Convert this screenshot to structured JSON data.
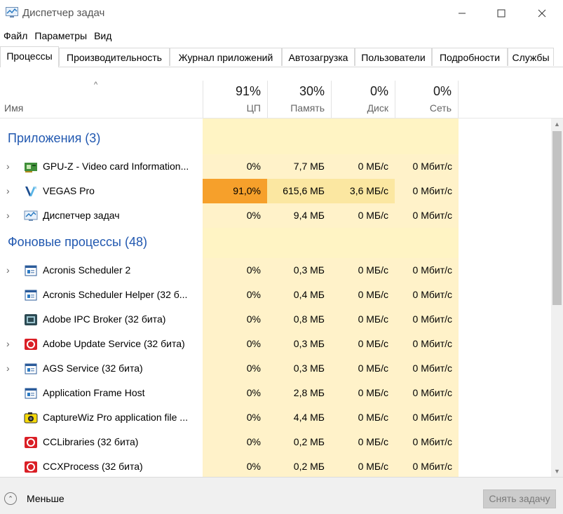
{
  "window": {
    "title": "Диспетчер задач",
    "minimize_glyph": "—",
    "maximize_glyph": "☐",
    "close_glyph": "✕"
  },
  "menu": [
    "Файл",
    "Параметры",
    "Вид"
  ],
  "tabs": [
    {
      "label": "Процессы",
      "active": true
    },
    {
      "label": "Производительность"
    },
    {
      "label": "Журнал приложений"
    },
    {
      "label": "Автозагрузка"
    },
    {
      "label": "Пользователи"
    },
    {
      "label": "Подробности"
    },
    {
      "label": "Службы"
    }
  ],
  "columns": {
    "name": "Имя",
    "sort_arrow": "^",
    "cpu": {
      "percent": "91%",
      "label": "ЦП"
    },
    "memory": {
      "percent": "30%",
      "label": "Память"
    },
    "disk": {
      "percent": "0%",
      "label": "Диск"
    },
    "network": {
      "percent": "0%",
      "label": "Сеть"
    }
  },
  "groups": [
    {
      "title": "Приложения (3)",
      "processes": [
        {
          "name": "GPU-Z - Video card Information...",
          "icon": "gpu-card-icon",
          "expandable": true,
          "cpu": "0%",
          "memory": "7,7 МБ",
          "disk": "0 МБ/с",
          "network": "0 Мбит/с",
          "level": 0
        },
        {
          "name": "VEGAS Pro",
          "icon": "vegas-icon",
          "expandable": true,
          "cpu": "91,0%",
          "memory": "615,6 МБ",
          "disk": "3,6 МБ/с",
          "network": "0 Мбит/с",
          "level": 3
        },
        {
          "name": "Диспетчер задач",
          "icon": "task-manager-icon",
          "expandable": true,
          "cpu": "0%",
          "memory": "9,4 МБ",
          "disk": "0 МБ/с",
          "network": "0 Мбит/с",
          "level": 0
        }
      ]
    },
    {
      "title": "Фоновые процессы (48)",
      "processes": [
        {
          "name": "Acronis Scheduler 2",
          "icon": "window-app-icon",
          "expandable": true,
          "cpu": "0%",
          "memory": "0,3 МБ",
          "disk": "0 МБ/с",
          "network": "0 Мбит/с",
          "level": 0
        },
        {
          "name": "Acronis Scheduler Helper (32 б...",
          "icon": "window-app-icon",
          "expandable": false,
          "cpu": "0%",
          "memory": "0,4 МБ",
          "disk": "0 МБ/с",
          "network": "0 Мбит/с",
          "level": 0
        },
        {
          "name": "Adobe IPC Broker (32 бита)",
          "icon": "adobe-ipc-icon",
          "expandable": false,
          "cpu": "0%",
          "memory": "0,8 МБ",
          "disk": "0 МБ/с",
          "network": "0 Мбит/с",
          "level": 0
        },
        {
          "name": "Adobe Update Service (32 бита)",
          "icon": "adobe-cc-icon",
          "expandable": true,
          "cpu": "0%",
          "memory": "0,3 МБ",
          "disk": "0 МБ/с",
          "network": "0 Мбит/с",
          "level": 0
        },
        {
          "name": "AGS Service (32 бита)",
          "icon": "window-app-icon",
          "expandable": true,
          "cpu": "0%",
          "memory": "0,3 МБ",
          "disk": "0 МБ/с",
          "network": "0 Мбит/с",
          "level": 0
        },
        {
          "name": "Application Frame Host",
          "icon": "window-app-icon",
          "expandable": false,
          "cpu": "0%",
          "memory": "2,8 МБ",
          "disk": "0 МБ/с",
          "network": "0 Мбит/с",
          "level": 0
        },
        {
          "name": "CaptureWiz Pro application file ...",
          "icon": "capturewiz-icon",
          "expandable": false,
          "cpu": "0%",
          "memory": "4,4 МБ",
          "disk": "0 МБ/с",
          "network": "0 Мбит/с",
          "level": 0
        },
        {
          "name": "CCLibraries (32 бита)",
          "icon": "adobe-cc-icon",
          "expandable": false,
          "cpu": "0%",
          "memory": "0,2 МБ",
          "disk": "0 МБ/с",
          "network": "0 Мбит/с",
          "level": 0
        },
        {
          "name": "CCXProcess (32 бита)",
          "icon": "adobe-cc-icon",
          "expandable": false,
          "cpu": "0%",
          "memory": "0,2 МБ",
          "disk": "0 МБ/с",
          "network": "0 Мбит/с",
          "level": 0
        }
      ]
    }
  ],
  "heat_colors": {
    "base": "#fff4c4",
    "low": "#fff2c9",
    "mid": "#fbe7a1",
    "hot": "#f7b33b",
    "max": "#f6a02b"
  },
  "footer": {
    "less_label": "Меньше",
    "end_task_label": "Снять задачу"
  }
}
